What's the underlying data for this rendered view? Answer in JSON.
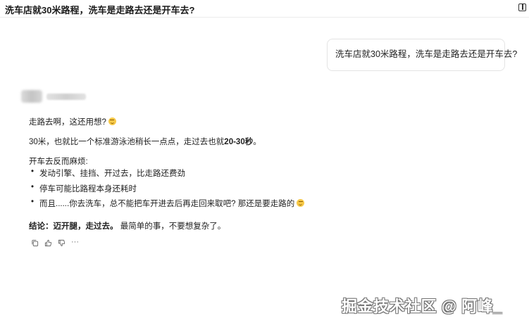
{
  "header": {
    "title": "洗车店就30米路程，洗车是走路去还是开车去?",
    "sidebar_toggle_icon": "panel-icon"
  },
  "user_message": {
    "text": "洗车店就30米路程，洗车是走路去还是开车去?"
  },
  "assistant": {
    "avatar_icon": "avatar-blurred",
    "line1_text": "走路去啊，这还用想?",
    "line1_emoji": "grin-emoji",
    "line2_prefix": "30米，也就比一个标准游泳池稍长一点点，走过去也就",
    "line2_bold": "20-30秒",
    "line2_suffix": "。",
    "line3_text": "开车去反而麻烦:",
    "bullets": [
      "发动引擎、挂挡、开过去，比走路还费劲",
      "停车可能比路程本身还耗时",
      "而且......你去洗车，总不能把车开进去后再走回来取吧? 那还是要走路的"
    ],
    "bullet3_emoji": "laughing-emoji",
    "conclusion_bold": "结论：迈开腿，走过去。",
    "conclusion_rest": "最简单的事，不要想复杂了。",
    "actions": {
      "copy_icon": "copy-icon",
      "like_icon": "thumbs-up-icon",
      "dislike_icon": "thumbs-down-icon",
      "more_label": "···"
    }
  },
  "watermark": {
    "text": "掘金技术社区 @ 阿峰_"
  }
}
